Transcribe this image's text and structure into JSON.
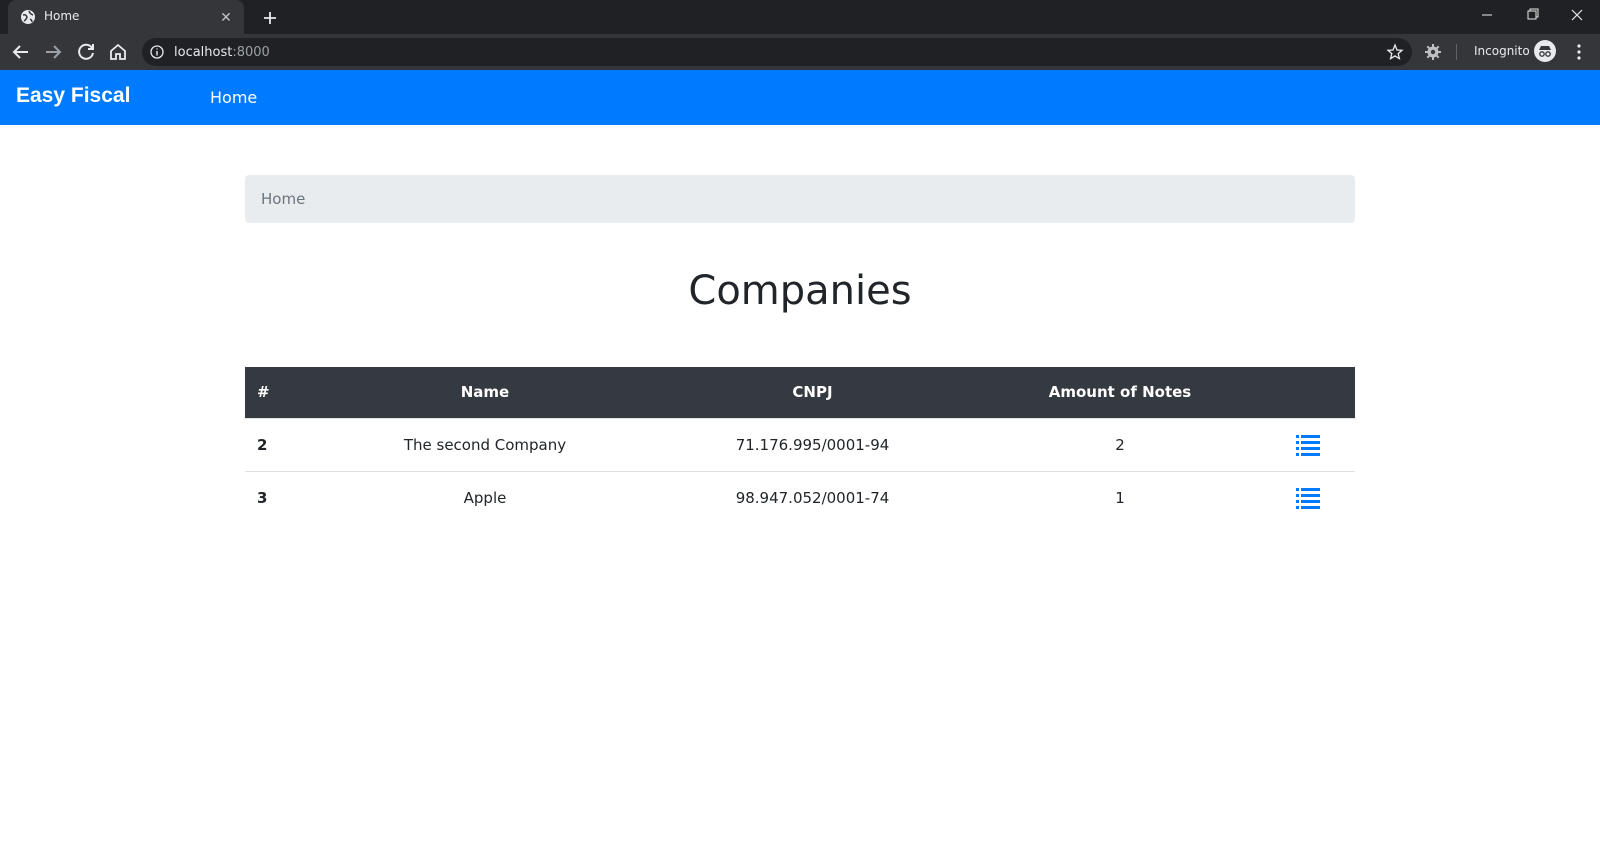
{
  "browser": {
    "tab_title": "Home",
    "url_host": "localhost",
    "url_port": ":8000",
    "incognito_label": "Incognito"
  },
  "navbar": {
    "brand": "Easy Fiscal",
    "links": [
      "Home"
    ]
  },
  "breadcrumb": {
    "items": [
      "Home"
    ]
  },
  "page": {
    "title": "Companies"
  },
  "table": {
    "headers": [
      "#",
      "Name",
      "CNPJ",
      "Amount of Notes",
      ""
    ],
    "rows": [
      {
        "id": "2",
        "name": "The second Company",
        "cnpj": "71.176.995/0001-94",
        "notes": "2",
        "action_icon": "list-icon"
      },
      {
        "id": "3",
        "name": "Apple",
        "cnpj": "98.947.052/0001-74",
        "notes": "1",
        "action_icon": "list-icon"
      }
    ]
  },
  "colors": {
    "navbar": "#007bff",
    "table_header": "#343a40",
    "breadcrumb_bg": "#e9ecef",
    "icon_accent": "#007bff"
  }
}
